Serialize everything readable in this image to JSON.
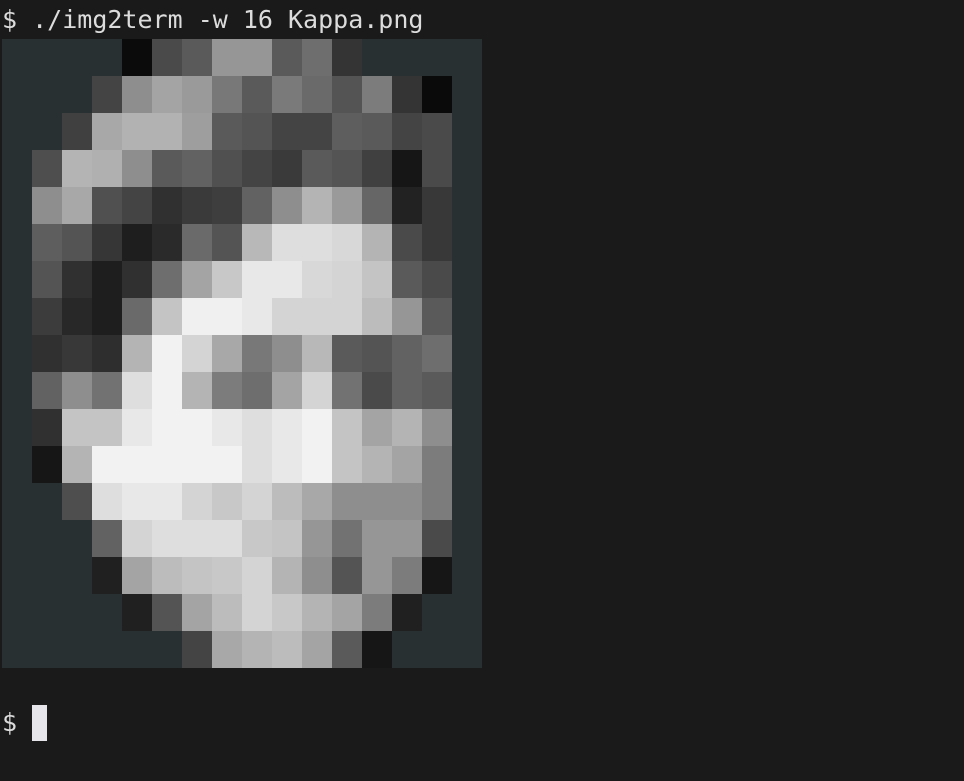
{
  "terminal": {
    "command_prompt": "$",
    "command": "./img2term -w 16 Kappa.png",
    "input_prompt": "$",
    "input_value": ""
  },
  "image": {
    "name": "Kappa.png",
    "width_cells": 16,
    "height_cells": 17,
    "pixels": [
      [
        "#293032",
        "#293032",
        "#293032",
        "#293032",
        "#0b0b0b",
        "#4a4a4a",
        "#5a5a5a",
        "#969696",
        "#969696",
        "#5a5a5a",
        "#6e6e6e",
        "#343434",
        "#293032",
        "#293032",
        "#293032",
        "#293032"
      ],
      [
        "#293032",
        "#293032",
        "#293032",
        "#444444",
        "#8e8e8e",
        "#a4a4a4",
        "#9a9a9a",
        "#787878",
        "#5a5a5a",
        "#7a7a7a",
        "#6a6a6a",
        "#545454",
        "#7c7c7c",
        "#343434",
        "#0a0a0a",
        "#293032"
      ],
      [
        "#293032",
        "#293032",
        "#404040",
        "#a8a8a8",
        "#b2b2b2",
        "#b2b2b2",
        "#9e9e9e",
        "#5a5a5a",
        "#545454",
        "#444444",
        "#444444",
        "#5e5e5e",
        "#5a5a5a",
        "#444444",
        "#4a4a4a",
        "#293032"
      ],
      [
        "#293032",
        "#4e4e4e",
        "#b4b4b4",
        "#b0b0b0",
        "#8e8e8e",
        "#5a5a5a",
        "#626262",
        "#505050",
        "#444444",
        "#3a3a3a",
        "#5a5a5a",
        "#545454",
        "#404040",
        "#161616",
        "#4a4a4a",
        "#293032"
      ],
      [
        "#293032",
        "#8e8e8e",
        "#a8a8a8",
        "#505050",
        "#444444",
        "#303030",
        "#3a3a3a",
        "#3e3e3e",
        "#626262",
        "#8e8e8e",
        "#b4b4b4",
        "#9a9a9a",
        "#666666",
        "#222222",
        "#383838",
        "#293032"
      ],
      [
        "#293032",
        "#5e5e5e",
        "#545454",
        "#363636",
        "#1e1e1e",
        "#2a2a2a",
        "#6a6a6a",
        "#545454",
        "#b8b8b8",
        "#dedede",
        "#dedede",
        "#d8d8d8",
        "#b4b4b4",
        "#4a4a4a",
        "#383838",
        "#293032"
      ],
      [
        "#293032",
        "#545454",
        "#303030",
        "#1e1e1e",
        "#303030",
        "#6e6e6e",
        "#a4a4a4",
        "#c8c8c8",
        "#e8e8e8",
        "#e8e8e8",
        "#d8d8d8",
        "#d4d4d4",
        "#c4c4c4",
        "#5a5a5a",
        "#4a4a4a",
        "#293032"
      ],
      [
        "#293032",
        "#3c3c3c",
        "#282828",
        "#1e1e1e",
        "#6a6a6a",
        "#c4c4c4",
        "#f0f0f0",
        "#f0f0f0",
        "#e8e8e8",
        "#d4d4d4",
        "#d4d4d4",
        "#d4d4d4",
        "#bcbcbc",
        "#969696",
        "#5a5a5a",
        "#293032"
      ],
      [
        "#293032",
        "#303030",
        "#383838",
        "#2e2e2e",
        "#b4b4b4",
        "#f2f2f2",
        "#d4d4d4",
        "#a8a8a8",
        "#787878",
        "#8e8e8e",
        "#b8b8b8",
        "#5a5a5a",
        "#545454",
        "#626262",
        "#6e6e6e",
        "#293032"
      ],
      [
        "#293032",
        "#626262",
        "#8e8e8e",
        "#727272",
        "#dedede",
        "#f2f2f2",
        "#b4b4b4",
        "#7c7c7c",
        "#6e6e6e",
        "#a4a4a4",
        "#d4d4d4",
        "#727272",
        "#4a4a4a",
        "#626262",
        "#5a5a5a",
        "#293032"
      ],
      [
        "#293032",
        "#303030",
        "#c4c4c4",
        "#c4c4c4",
        "#e8e8e8",
        "#f2f2f2",
        "#f2f2f2",
        "#e8e8e8",
        "#dedede",
        "#e8e8e8",
        "#f2f2f2",
        "#c4c4c4",
        "#a4a4a4",
        "#b4b4b4",
        "#8e8e8e",
        "#293032"
      ],
      [
        "#293032",
        "#161616",
        "#b4b4b4",
        "#f2f2f2",
        "#f2f2f2",
        "#f2f2f2",
        "#f2f2f2",
        "#f2f2f2",
        "#dedede",
        "#e8e8e8",
        "#f2f2f2",
        "#c4c4c4",
        "#b4b4b4",
        "#a4a4a4",
        "#7c7c7c",
        "#293032"
      ],
      [
        "#293032",
        "#293032",
        "#4e4e4e",
        "#dedede",
        "#e8e8e8",
        "#e8e8e8",
        "#d4d4d4",
        "#c8c8c8",
        "#d4d4d4",
        "#bcbcbc",
        "#a8a8a8",
        "#8e8e8e",
        "#8e8e8e",
        "#8e8e8e",
        "#7c7c7c",
        "#293032"
      ],
      [
        "#293032",
        "#293032",
        "#293032",
        "#626262",
        "#d4d4d4",
        "#dedede",
        "#dedede",
        "#dedede",
        "#c8c8c8",
        "#c4c4c4",
        "#969696",
        "#727272",
        "#969696",
        "#969696",
        "#4a4a4a",
        "#293032"
      ],
      [
        "#293032",
        "#293032",
        "#293032",
        "#202020",
        "#a4a4a4",
        "#bcbcbc",
        "#c4c4c4",
        "#c8c8c8",
        "#d4d4d4",
        "#b4b4b4",
        "#8e8e8e",
        "#545454",
        "#969696",
        "#7c7c7c",
        "#161616",
        "#293032"
      ],
      [
        "#293032",
        "#293032",
        "#293032",
        "#293032",
        "#202020",
        "#545454",
        "#a4a4a4",
        "#bcbcbc",
        "#d4d4d4",
        "#c8c8c8",
        "#b4b4b4",
        "#a4a4a4",
        "#7c7c7c",
        "#202020",
        "#293032",
        "#293032"
      ],
      [
        "#293032",
        "#293032",
        "#293032",
        "#293032",
        "#293032",
        "#293032",
        "#444444",
        "#a8a8a8",
        "#b4b4b4",
        "#bcbcbc",
        "#a4a4a4",
        "#5a5a5a",
        "#161616",
        "#293032",
        "#293032",
        "#293032"
      ]
    ]
  }
}
